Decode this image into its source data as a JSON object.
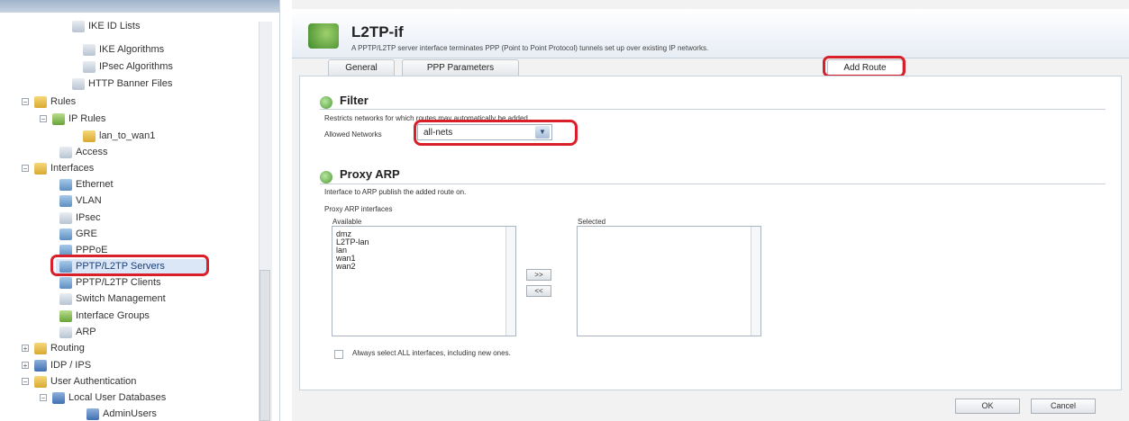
{
  "tree": {
    "items": [
      {
        "label": "IKE ID Lists"
      },
      {
        "label": "IKE Algorithms"
      },
      {
        "label": "IPsec Algorithms"
      },
      {
        "label": "HTTP Banner Files"
      },
      {
        "label": "Rules"
      },
      {
        "label": "IP Rules"
      },
      {
        "label": "lan_to_wan1"
      },
      {
        "label": "Access"
      },
      {
        "label": "Interfaces"
      },
      {
        "label": "Ethernet"
      },
      {
        "label": "VLAN"
      },
      {
        "label": "IPsec"
      },
      {
        "label": "GRE"
      },
      {
        "label": "PPPoE"
      },
      {
        "label": "PPTP/L2TP Servers"
      },
      {
        "label": "PPTP/L2TP Clients"
      },
      {
        "label": "Switch Management"
      },
      {
        "label": "Interface Groups"
      },
      {
        "label": "ARP"
      },
      {
        "label": "Routing"
      },
      {
        "label": "IDP / IPS"
      },
      {
        "label": "User Authentication"
      },
      {
        "label": "Local User Databases"
      },
      {
        "label": "AdminUsers"
      }
    ]
  },
  "header": {
    "title": "L2TP-if",
    "subtitle": "A PPTP/L2TP server interface terminates PPP (Point to Point Protocol) tunnels set up over existing IP networks."
  },
  "tabs": [
    {
      "label": "General"
    },
    {
      "label": "PPP Parameters"
    },
    {
      "label": "Add Route"
    }
  ],
  "filter": {
    "title": "Filter",
    "description": "Restricts networks for which routes may automatically be added.",
    "allowed_label": "Allowed Networks",
    "allowed_value": "all-nets"
  },
  "proxy_arp": {
    "title": "Proxy ARP",
    "description": "Interface to ARP publish the added route on.",
    "interfaces_label": "Proxy ARP interfaces",
    "available_label": "Available",
    "selected_label": "Selected",
    "available": [
      "dmz",
      "L2TP-lan",
      "lan",
      "wan1",
      "wan2"
    ],
    "selected": [],
    "add_label": ">>",
    "remove_label": "<<",
    "always_select_label": "Always select ALL interfaces, including new ones."
  },
  "buttons": {
    "ok": "OK",
    "cancel": "Cancel"
  }
}
